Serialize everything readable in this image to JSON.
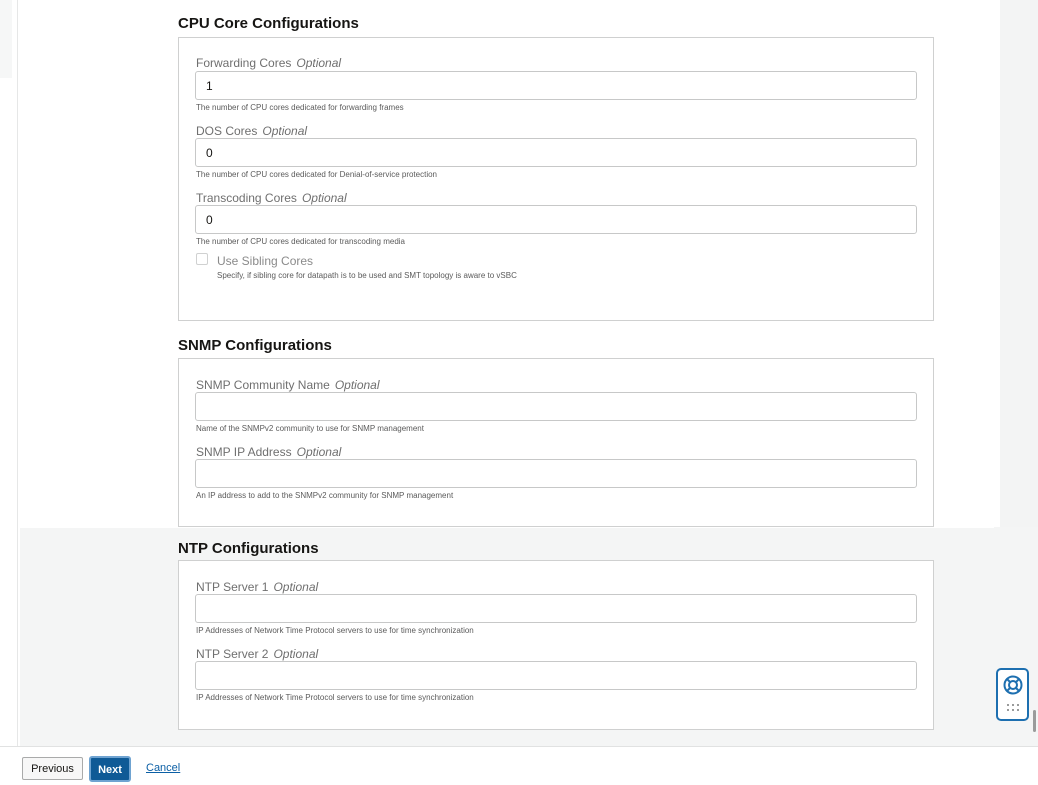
{
  "cpu": {
    "title": "CPU Core Configurations",
    "forwarding": {
      "label": "Forwarding Cores",
      "optional": "Optional",
      "value": "1",
      "help": "The number of CPU cores dedicated for forwarding frames"
    },
    "dos": {
      "label": "DOS Cores",
      "optional": "Optional",
      "value": "0",
      "help": "The number of CPU cores dedicated for Denial-of-service protection"
    },
    "transcoding": {
      "label": "Transcoding Cores",
      "optional": "Optional",
      "value": "0",
      "help": "The number of CPU cores dedicated for transcoding media"
    },
    "sibling": {
      "label": "Use Sibling Cores",
      "checked": false,
      "help": "Specify, if sibling core for datapath is to be used and SMT topology is aware to vSBC"
    }
  },
  "snmp": {
    "title": "SNMP Configurations",
    "community": {
      "label": "SNMP Community Name",
      "optional": "Optional",
      "value": "",
      "help": "Name of the SNMPv2 community to use for SNMP management"
    },
    "ip": {
      "label": "SNMP IP Address",
      "optional": "Optional",
      "value": "",
      "help": "An IP address to add to the SNMPv2 community for SNMP management"
    }
  },
  "ntp": {
    "title": "NTP Configurations",
    "server1": {
      "label": "NTP Server 1",
      "optional": "Optional",
      "value": "",
      "help": "IP Addresses of Network Time Protocol servers to use for time synchronization"
    },
    "server2": {
      "label": "NTP Server 2",
      "optional": "Optional",
      "value": "",
      "help": "IP Addresses of Network Time Protocol servers to use for time synchronization"
    }
  },
  "footer": {
    "previous_label": "Previous",
    "next_label": "Next",
    "cancel_label": "Cancel"
  },
  "icons": {
    "help_widget": "lifebuoy-icon",
    "apps": "grid-icon"
  },
  "colors": {
    "primary": "#0f5a96",
    "link": "#0b5fa5",
    "widget_border": "#1d6fb0"
  }
}
